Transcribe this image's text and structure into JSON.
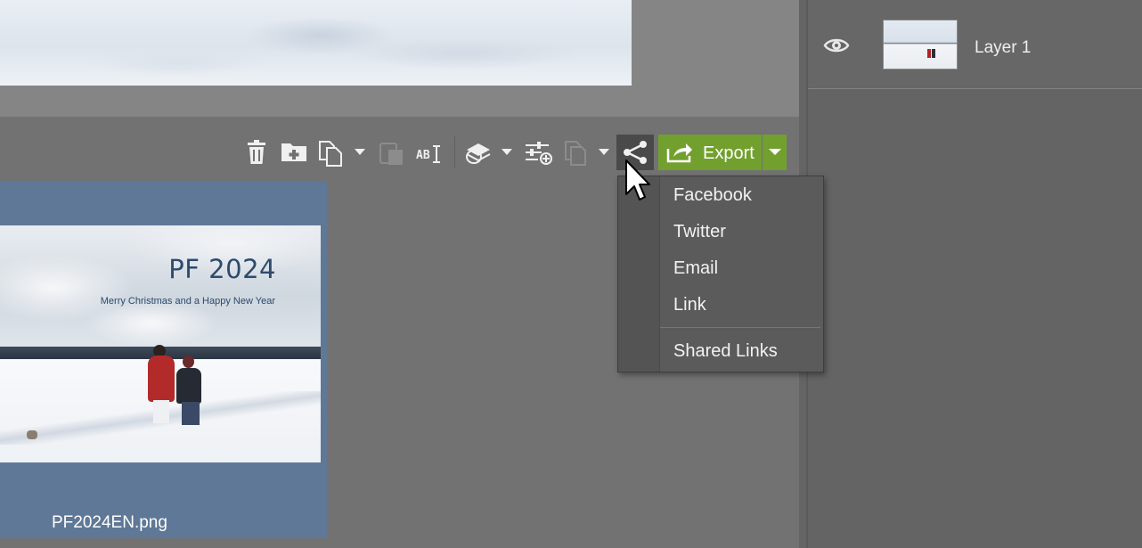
{
  "layers": {
    "items": [
      {
        "name": "Layer 1"
      }
    ]
  },
  "toolbar": {
    "export_label": "Export",
    "tools": [
      "trash-icon",
      "new-folder-icon",
      "copy-to-icon",
      "copy-to-dropdown",
      "paste-icon",
      "rename-icon",
      "layers-stack-icon",
      "layers-stack-dropdown",
      "adjust-add-icon",
      "copy-adjust-icon",
      "copy-adjust-dropdown",
      "share-icon"
    ]
  },
  "file": {
    "name": "PF2024EN.png",
    "card_title": "PF 2024",
    "card_subtitle": "Merry Christmas and a Happy New Year"
  },
  "share_menu": {
    "items": [
      "Facebook",
      "Twitter",
      "Email",
      "Link"
    ],
    "secondary": [
      "Shared Links"
    ]
  },
  "colors": {
    "accent_green": "#72a02e",
    "panel_bg": "#646464",
    "file_tile_bg": "#5f7897"
  }
}
